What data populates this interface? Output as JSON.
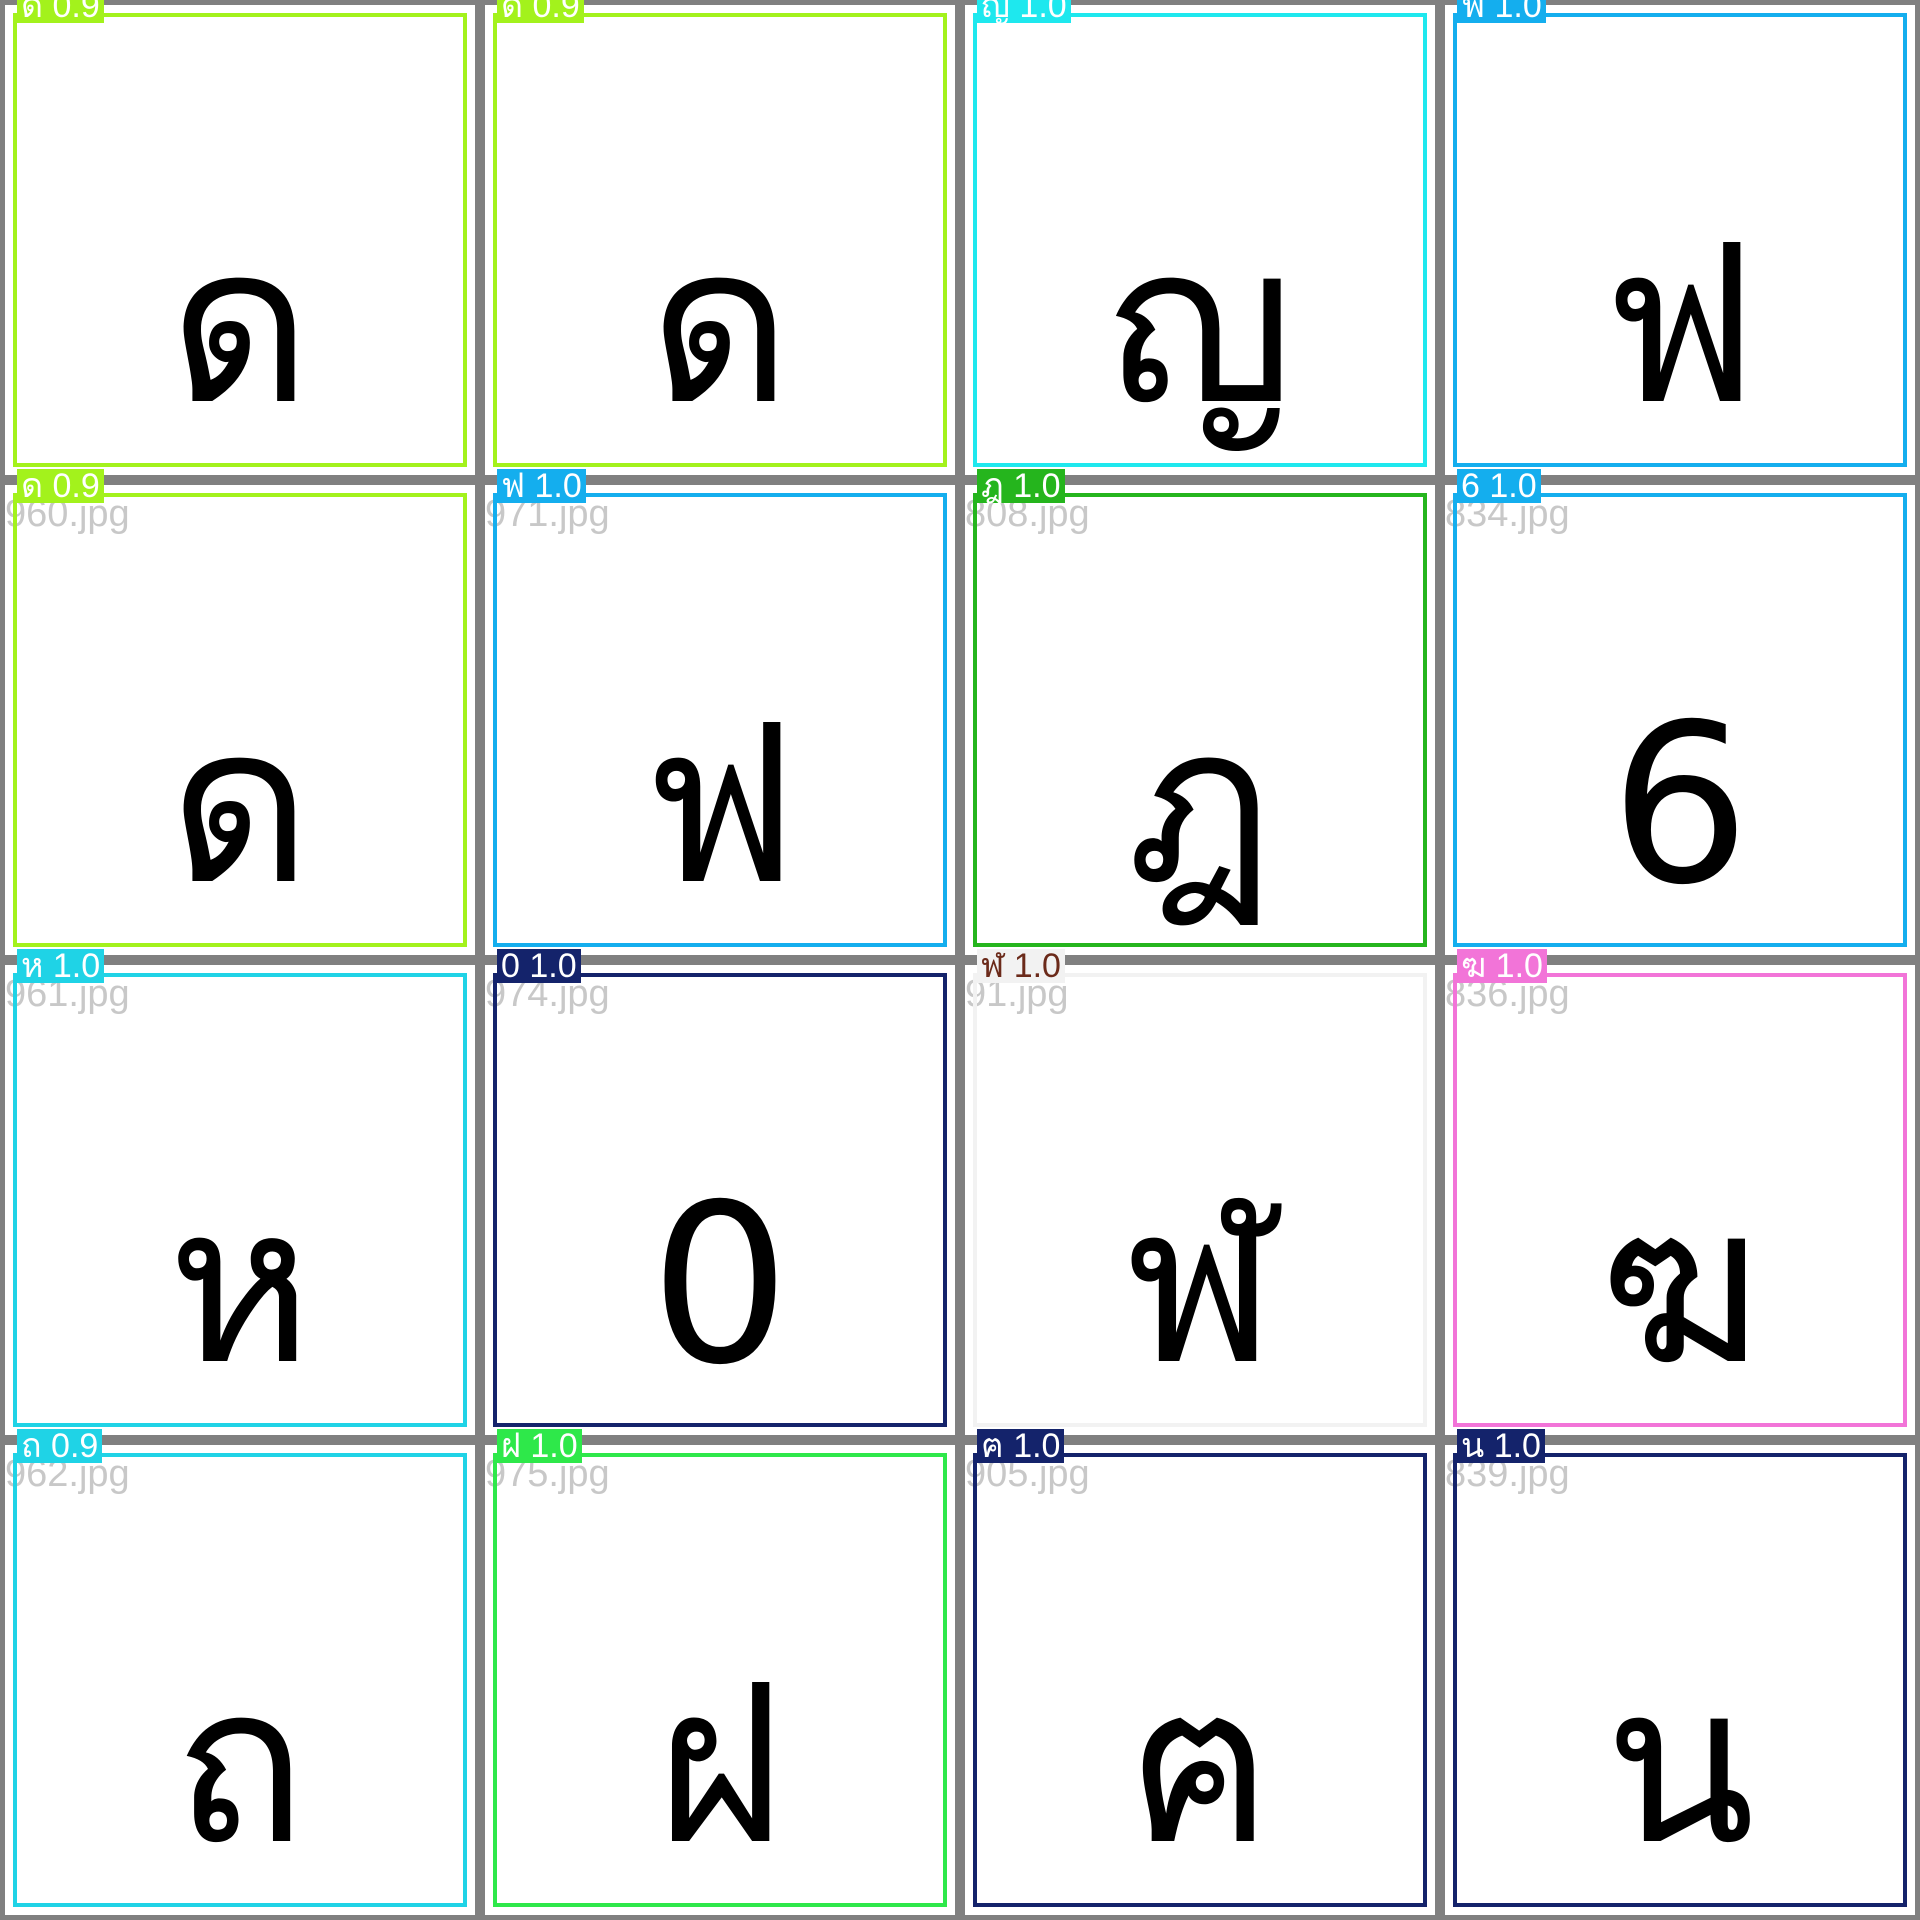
{
  "tiles": [
    {
      "filename": "",
      "glyph": "ด",
      "det_label": "ด 0.9",
      "det_color": "#a3f21c",
      "label_text_color": "#ffffff"
    },
    {
      "filename": "",
      "glyph": "ด",
      "det_label": "ด 0.9",
      "det_color": "#a3f21c",
      "label_text_color": "#ffffff"
    },
    {
      "filename": "",
      "glyph": "ญ",
      "det_label": "ญ 1.0",
      "det_color": "#1ee8ee",
      "label_text_color": "#ffffff"
    },
    {
      "filename": "",
      "glyph": "ฟ",
      "det_label": "ฟ 1.0",
      "det_color": "#14aeee",
      "label_text_color": "#ffffff"
    },
    {
      "filename": "960.jpg",
      "glyph": "ด",
      "det_label": "ด 0.9",
      "det_color": "#a3f21c",
      "label_text_color": "#ffffff"
    },
    {
      "filename": "971.jpg",
      "glyph": "ฟ",
      "det_label": "ฟ 1.0",
      "det_color": "#14aeee",
      "label_text_color": "#ffffff"
    },
    {
      "filename": "808.jpg",
      "glyph": "ฎ",
      "det_label": "ฎ 1.0",
      "det_color": "#25b51d",
      "label_text_color": "#ffffff"
    },
    {
      "filename": "834.jpg",
      "glyph": "6",
      "det_label": "6 1.0",
      "det_color": "#14aeee",
      "label_text_color": "#ffffff"
    },
    {
      "filename": "961.jpg",
      "glyph": "ห",
      "det_label": "ห 1.0",
      "det_color": "#1fd3e6",
      "label_text_color": "#ffffff"
    },
    {
      "filename": "974.jpg",
      "glyph": "0",
      "det_label": "0 1.0",
      "det_color": "#14236b",
      "label_text_color": "#ffffff"
    },
    {
      "filename": "91.jpg",
      "glyph": "ฬ",
      "det_label": "ฬ 1.0",
      "det_color": "#f2f2f2",
      "label_text_color": "#6b2a1a"
    },
    {
      "filename": "836.jpg",
      "glyph": "ฆ",
      "det_label": "ฆ 1.0",
      "det_color": "#f274d8",
      "label_text_color": "#ffffff"
    },
    {
      "filename": "962.jpg",
      "glyph": "ถ",
      "det_label": "ถ 0.9",
      "det_color": "#1fd3e6",
      "label_text_color": "#ffffff"
    },
    {
      "filename": "975.jpg",
      "glyph": "ฝ",
      "det_label": "ฝ 1.0",
      "det_color": "#2ee84a",
      "label_text_color": "#ffffff"
    },
    {
      "filename": "905.jpg",
      "glyph": "ฅ",
      "det_label": "ฅ 1.0",
      "det_color": "#14236b",
      "label_text_color": "#ffffff"
    },
    {
      "filename": "839.jpg",
      "glyph": "น",
      "det_label": "น 1.0",
      "det_color": "#14236b",
      "label_text_color": "#ffffff"
    }
  ]
}
